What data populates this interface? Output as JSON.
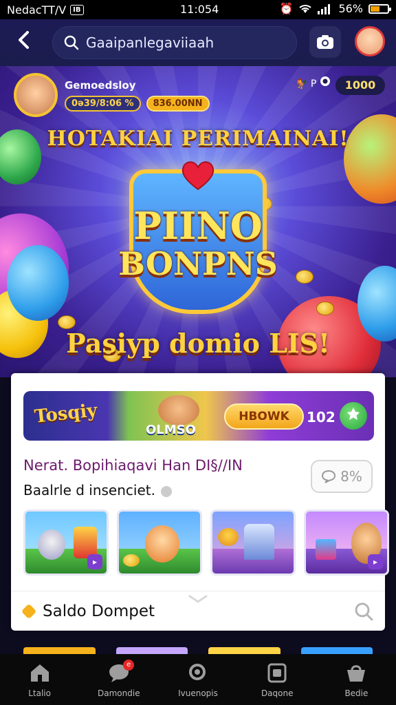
{
  "status_bar": {
    "carrier": "NedacTT/V",
    "badge": "IB",
    "time": "11:054",
    "battery": "56%",
    "battery_level": 0.56
  },
  "header": {
    "search_text": "Gaaipanlegaviiaah"
  },
  "banner": {
    "profile_name": "Gemoedsloy",
    "profile_stat": "0ə39/8:06 %",
    "profile_coins": "836.00NN",
    "coin_badge": "P",
    "coin_total": "1000",
    "headline": "HOTAKIAI PERIMAINAI!",
    "logo_line1": "PIINO",
    "logo_line2": "BONPNS",
    "subline": "Pasiyp domio LIS!"
  },
  "card": {
    "promo_logo": "Tosqiy",
    "promo_tag": "OLMSO",
    "promo_button": "HBOWK",
    "promo_count": "102",
    "title": "Nerat. Bopihiaqavi Han DI§//IN",
    "subtitle": "Baalrle d insenciet.",
    "percent_chip": "8%",
    "wallet_label": "Saldo Dompet"
  },
  "nav": {
    "items": [
      {
        "label": "Ltalio",
        "icon": "home-icon"
      },
      {
        "label": "Damondie",
        "icon": "chat-icon",
        "badge": "e"
      },
      {
        "label": "Ivuenopis",
        "icon": "search-icon"
      },
      {
        "label": "Daqone",
        "icon": "calendar-icon"
      },
      {
        "label": "Bedie",
        "icon": "basket-icon"
      }
    ]
  },
  "colors": {
    "header_bg": "#1d1b55",
    "banner_gold": "#ffd23f",
    "card_title": "#6b1a6b",
    "coin_orange": "#f5b21c",
    "nav_bg": "#0a0a0a"
  }
}
